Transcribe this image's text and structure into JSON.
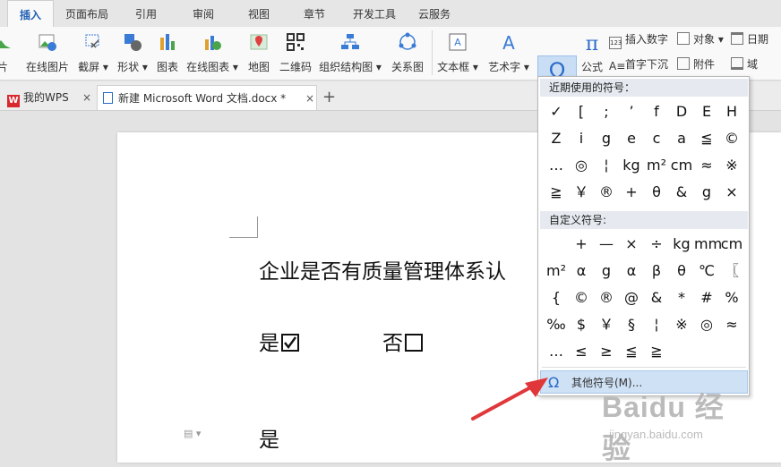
{
  "menu_tabs": [
    "插入",
    "页面布局",
    "引用",
    "审阅",
    "视图",
    "章节",
    "开发工具",
    "云服务"
  ],
  "ribbon": {
    "buttons": [
      "片",
      "在线图片",
      "截屏",
      "形状",
      "图表",
      "在线图表",
      "地图",
      "二维码",
      "组织结构图",
      "关系图",
      "文本框",
      "艺术字",
      "符号",
      "公式"
    ],
    "small": [
      "插入数字",
      "对象",
      "日期",
      "首字下沉",
      "附件",
      "域"
    ]
  },
  "doc_tabs": {
    "wps": "我的WPS",
    "doc": "新建 Microsoft Word 文档.docx *",
    "add": "+",
    "close": "×"
  },
  "document": {
    "question": "企业是否有质量管理体系认",
    "yes": "是",
    "no": "否",
    "yes2": "是"
  },
  "symbol_menu": {
    "recent_label": "近期使用的符号：",
    "recent": [
      "✓",
      "[",
      ";",
      "’",
      "f",
      "D",
      "E",
      "H",
      "Z",
      "i",
      "g",
      "e",
      "c",
      "a",
      "≦",
      "©",
      "…",
      "◎",
      "¦",
      "kg",
      "m²",
      "cm",
      "≈",
      "※",
      "≧",
      "￥",
      "®",
      "+",
      "θ",
      "&",
      "g",
      "×"
    ],
    "custom_label": "自定义符号:",
    "custom": [
      "",
      "+",
      "—",
      "×",
      "÷",
      "kg",
      "mm",
      "cm",
      "m²",
      "α",
      "g",
      "α",
      "β",
      "θ",
      "℃",
      "〖",
      "{",
      "©",
      "®",
      "@",
      "&",
      "*",
      "#",
      "%",
      "‰",
      "$",
      "￥",
      "§",
      "¦",
      "※",
      "◎",
      "≈",
      "…",
      "≤",
      "≥",
      "≦",
      "≧"
    ],
    "other": "其他符号(M)..."
  },
  "watermark": {
    "brand": "Baidu 经验",
    "url": "jingyan.baidu.com"
  },
  "colors": {
    "accent": "#1e5fb4",
    "arrow": "#e0383a",
    "selected": "#c9def5"
  }
}
